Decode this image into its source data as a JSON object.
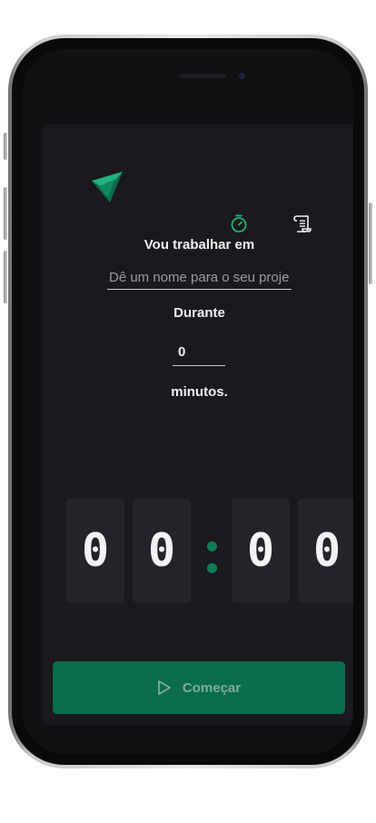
{
  "header": {
    "logo_icon": "triangle-logo-icon",
    "nav": [
      {
        "icon": "stopwatch-icon",
        "active": true
      },
      {
        "icon": "scroll-history-icon",
        "active": false
      }
    ]
  },
  "form": {
    "task_label": "Vou trabalhar em",
    "task_placeholder": "Dê um nome para o seu projeto",
    "task_value": "",
    "duration_label": "Durante",
    "minutes_value": "0",
    "minutes_suffix": "minutos."
  },
  "countdown": {
    "minutes": [
      "0",
      "0"
    ],
    "seconds": [
      "0",
      "0"
    ],
    "separator_icon": "colon-separator-icon"
  },
  "start_button": {
    "label": "Começar",
    "icon": "play-icon"
  },
  "colors": {
    "accent": "#0a6d4b",
    "accent_light": "#1fb27a",
    "background": "#111113",
    "panel": "#1a191d",
    "digit_card": "#242328"
  }
}
